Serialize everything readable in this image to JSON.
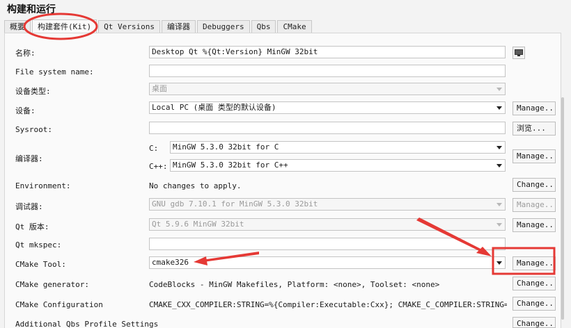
{
  "title": "构建和运行",
  "tabs": [
    "概要",
    "构建套件(Kit)",
    "Qt Versions",
    "编译器",
    "Debuggers",
    "Qbs",
    "CMake"
  ],
  "rows": {
    "name": {
      "label": "名称:",
      "value": "Desktop Qt %{Qt:Version} MinGW 32bit"
    },
    "fs_name": {
      "label": "File system name:",
      "value": ""
    },
    "device_type": {
      "label": "设备类型:",
      "value": "桌面"
    },
    "device": {
      "label": "设备:",
      "value": "Local PC (桌面 类型的默认设备)",
      "button": "Manage..."
    },
    "sysroot": {
      "label": "Sysroot:",
      "value": "",
      "button": "浏览..."
    },
    "compiler": {
      "label": "编译器:",
      "c_label": "C:",
      "c_value": "MinGW 5.3.0 32bit for C",
      "cpp_label": "C++:",
      "cpp_value": "MinGW 5.3.0 32bit for C++",
      "button": "Manage..."
    },
    "environment": {
      "label": "Environment:",
      "value": "No changes to apply.",
      "button": "Change..."
    },
    "debugger": {
      "label": "调试器:",
      "value": "GNU gdb 7.10.1 for MinGW 5.3.0 32bit",
      "button": "Manage..."
    },
    "qt_version": {
      "label": "Qt 版本:",
      "value": "Qt 5.9.6 MinGW 32bit",
      "button": "Manage..."
    },
    "qt_mkspec": {
      "label": "Qt mkspec:",
      "value": ""
    },
    "cmake_tool": {
      "label": "CMake Tool:",
      "value": "cmake326",
      "button": "Manage..."
    },
    "cmake_generator": {
      "label": "CMake generator:",
      "value": "CodeBlocks - MinGW Makefiles, Platform: <none>, Toolset: <none>",
      "button": "Change..."
    },
    "cmake_config": {
      "label": "CMake Configuration",
      "value": "CMAKE_CXX_COMPILER:STRING=%{Compiler:Executable:Cxx}; CMAKE_C_COMPILER:STRING=%{Com",
      "button": "Change..."
    },
    "qbs_profile": {
      "label": "Additional Qbs Profile Settings",
      "button": "Change..."
    }
  },
  "annotation_color": "#e53935"
}
